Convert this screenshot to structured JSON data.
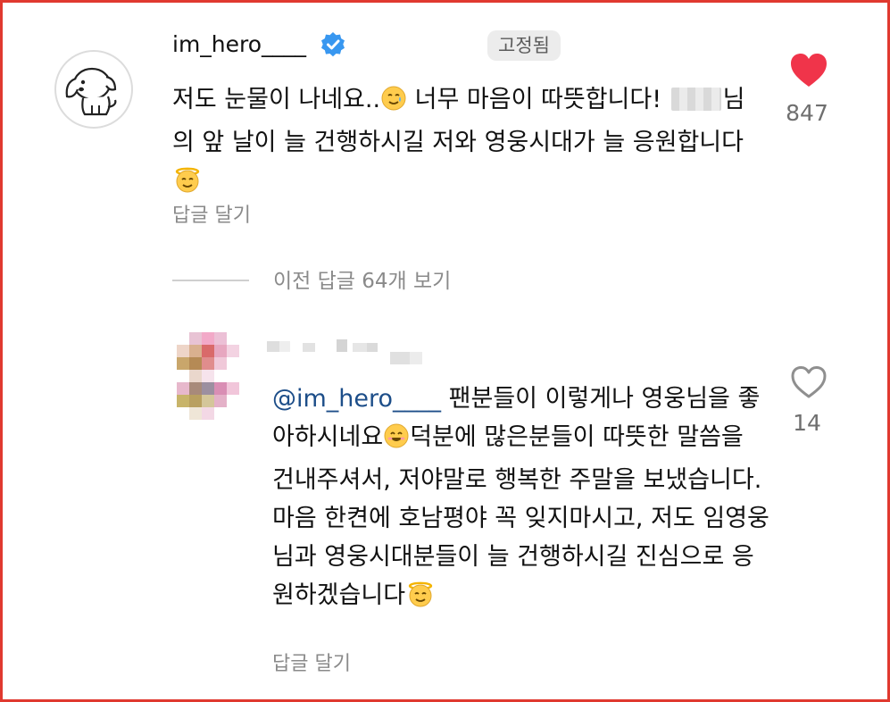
{
  "comment1": {
    "username": "im_hero____",
    "pinned_label": "고정됨",
    "text_part1": "저도 눈물이 나네요..",
    "text_part2": " 너무 마음이 따뜻합니다! ",
    "text_part3": "님의 앞 날이 늘 건행하시길 저와 영웅시대가 늘 응원합니다",
    "reply_label": "답글 달기",
    "like_count": "847",
    "liked": true
  },
  "view_previous": "이전 답글 64개 보기",
  "comment2": {
    "mention": "@im_hero____",
    "text_part1": " 팬분들이 이렇게나 영웅님을 좋아하시네요",
    "text_part2": "덕분에 많은분들이 따뜻한 말씀을 건내주셔서, 저야말로 행복한 주말을 보냈습니다. 마음 한켠에 호남평야 꼭 잊지마시고, 저도 임영웅님과 영웅시대분들이 늘 건행하시길 진심으로 응원하겠습니다",
    "reply_label": "답글 달기",
    "like_count": "14",
    "liked": false
  },
  "colors": {
    "border": "#e0392f",
    "heart_red": "#f0344a",
    "verified_blue": "#3897f0",
    "mention_blue": "#1d4e89",
    "muted_text": "#8a8a8a"
  },
  "icons": {
    "avatar1": "puppy-avatar-icon",
    "verified": "verified-badge-icon",
    "heart_filled": "heart-filled-icon",
    "heart_outline": "heart-outline-icon",
    "emoji_tear": "smiling-face-with-tear-icon",
    "emoji_halo": "smiling-face-with-halo-icon",
    "emoji_smile": "smiling-face-icon"
  }
}
